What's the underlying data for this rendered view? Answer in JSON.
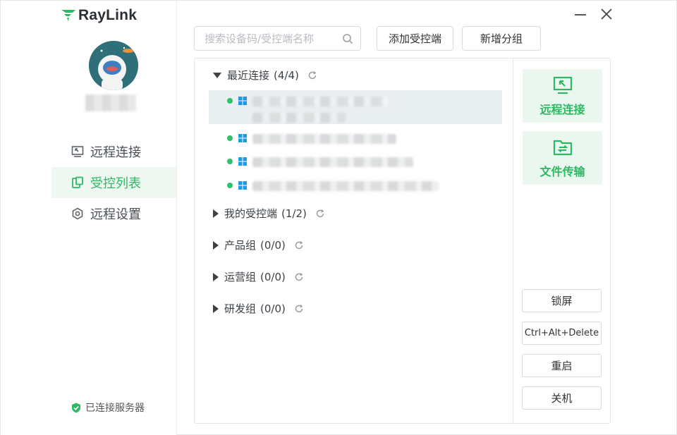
{
  "app": {
    "name": "RayLink"
  },
  "sidebar": {
    "nav": [
      {
        "label": "远程连接",
        "icon": "remote-connect-icon"
      },
      {
        "label": "受控列表",
        "icon": "controlled-list-icon",
        "active": true
      },
      {
        "label": "远程设置",
        "icon": "settings-icon"
      }
    ],
    "server_status": "已连接服务器"
  },
  "toolbar": {
    "search_placeholder": "搜索设备码/受控端名称",
    "add_controlled": "添加受控端",
    "new_group": "新增分组"
  },
  "groups": [
    {
      "name": "最近连接",
      "count": "(4/4)",
      "expanded": true
    },
    {
      "name": "我的受控端",
      "count": "(1/2)",
      "expanded": false
    },
    {
      "name": "产品组",
      "count": "(0/0)",
      "expanded": false
    },
    {
      "name": "运营组",
      "count": "(0/0)",
      "expanded": false
    },
    {
      "name": "研发组",
      "count": "(0/0)",
      "expanded": false
    }
  ],
  "actions": {
    "remote_connect": "远程连接",
    "file_transfer": "文件传输",
    "lock_screen": "锁屏",
    "ctrl_alt_delete": "Ctrl+Alt+Delete",
    "restart": "重启",
    "shutdown": "关机"
  },
  "colors": {
    "accent": "#2fb863",
    "accent_bg": "#e9f7ee",
    "online": "#2fc26b",
    "windows_blue": "#1e9be0"
  }
}
